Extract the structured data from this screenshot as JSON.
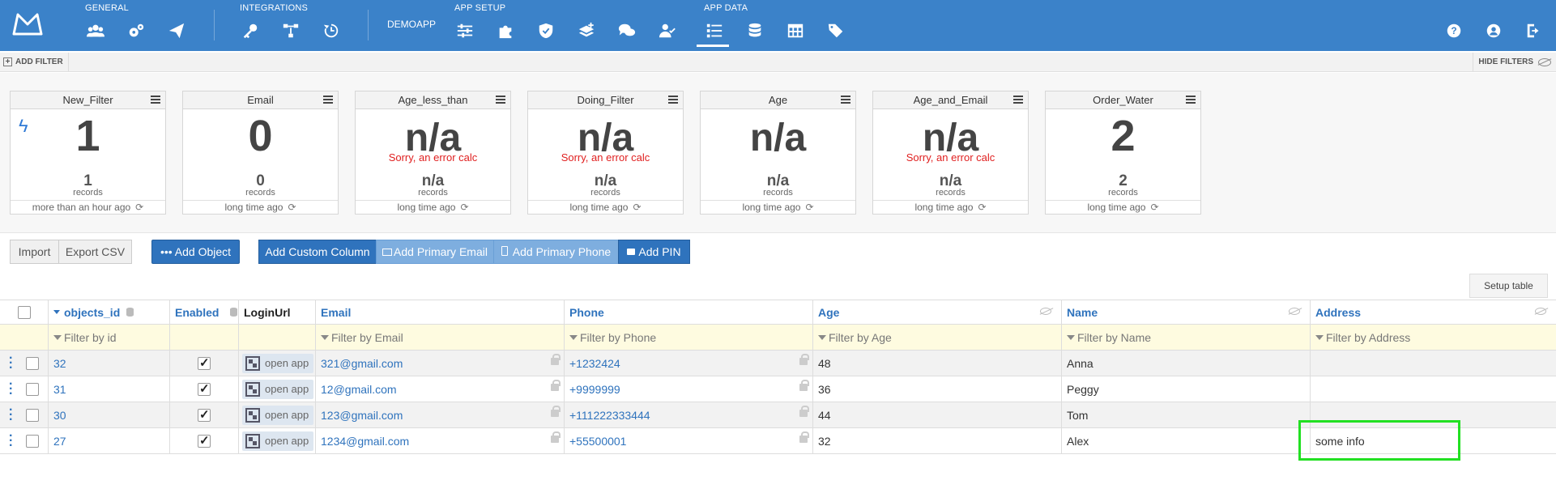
{
  "topbar": {
    "groups": {
      "general": "GENERAL",
      "integrations": "INTEGRATIONS",
      "demoapp": "DEMOAPP",
      "app_setup": "APP SETUP",
      "app_data": "APP DATA"
    },
    "icons": {
      "general": [
        "users-icon",
        "settings-icon",
        "send-icon"
      ],
      "integrations": [
        "key-icon",
        "flow-icon",
        "history-icon"
      ],
      "app_setup": [
        "sliders-icon",
        "puzzle-icon",
        "shield-icon",
        "layers-icon",
        "chat-icon",
        "user-check-icon"
      ],
      "app_data": [
        "list-icon",
        "database-icon",
        "table-icon",
        "tags-icon"
      ],
      "right": [
        "help-icon",
        "account-icon",
        "logout-icon"
      ]
    }
  },
  "filterbar": {
    "add_filter": "ADD FILTER",
    "hide_filters": "HIDE FILTERS"
  },
  "cards": [
    {
      "title": "New_Filter",
      "value": "1",
      "error": "",
      "count": "1",
      "count_label": "records",
      "updated": "more than an hour ago"
    },
    {
      "title": "Email",
      "value": "0",
      "error": "",
      "count": "0",
      "count_label": "records",
      "updated": "long time ago"
    },
    {
      "title": "Age_less_than",
      "value": "n/a",
      "error": "Sorry, an error calc",
      "count": "n/a",
      "count_label": "records",
      "updated": "long time ago"
    },
    {
      "title": "Doing_Filter",
      "value": "n/a",
      "error": "Sorry, an error calc",
      "count": "n/a",
      "count_label": "records",
      "updated": "long time ago"
    },
    {
      "title": "Age",
      "value": "n/a",
      "error": "",
      "count": "n/a",
      "count_label": "records",
      "updated": "long time ago"
    },
    {
      "title": "Age_and_Email",
      "value": "n/a",
      "error": "Sorry, an error calc",
      "count": "n/a",
      "count_label": "records",
      "updated": "long time ago"
    },
    {
      "title": "Order_Water",
      "value": "2",
      "error": "",
      "count": "2",
      "count_label": "records",
      "updated": "long time ago"
    }
  ],
  "buttons": {
    "import": "Import",
    "export_csv": "Export CSV",
    "add_object": "••• Add Object",
    "add_custom_column": "Add Custom Column",
    "add_primary_email": "Add Primary Email",
    "add_primary_phone": "Add Primary Phone",
    "add_pin": "Add PIN",
    "setup_table": "Setup table"
  },
  "table": {
    "headers": {
      "objects_id": "objects_id",
      "enabled": "Enabled",
      "login_url": "LoginUrl",
      "email": "Email",
      "phone": "Phone",
      "age": "Age",
      "name": "Name",
      "address": "Address"
    },
    "filters": {
      "id": "Filter by id",
      "email": "Filter by Email",
      "phone": "Filter by Phone",
      "age": "Filter by Age",
      "name": "Filter by Name",
      "address": "Filter by Address"
    },
    "rows": [
      {
        "id": "32",
        "enabled": true,
        "login": "open app",
        "email": "321@gmail.com",
        "phone": "+1232424",
        "age": "48",
        "name": "Anna",
        "address": ""
      },
      {
        "id": "31",
        "enabled": true,
        "login": "open app",
        "email": "12@gmail.com",
        "phone": "+9999999",
        "age": "36",
        "name": "Peggy",
        "address": ""
      },
      {
        "id": "30",
        "enabled": true,
        "login": "open app",
        "email": "123@gmail.com",
        "phone": "+111222333444",
        "age": "44",
        "name": "Tom",
        "address": ""
      },
      {
        "id": "27",
        "enabled": true,
        "login": "open app",
        "email": "1234@gmail.com",
        "phone": "+55500001",
        "age": "32",
        "name": "Alex",
        "address": "some info"
      }
    ]
  },
  "colors": {
    "topbar": "#3b82c9",
    "primary_button": "#2f73bd",
    "light_button": "#7eaedf",
    "error": "#e02020",
    "filter_row": "#fefbe0",
    "highlight": "#22e022"
  }
}
